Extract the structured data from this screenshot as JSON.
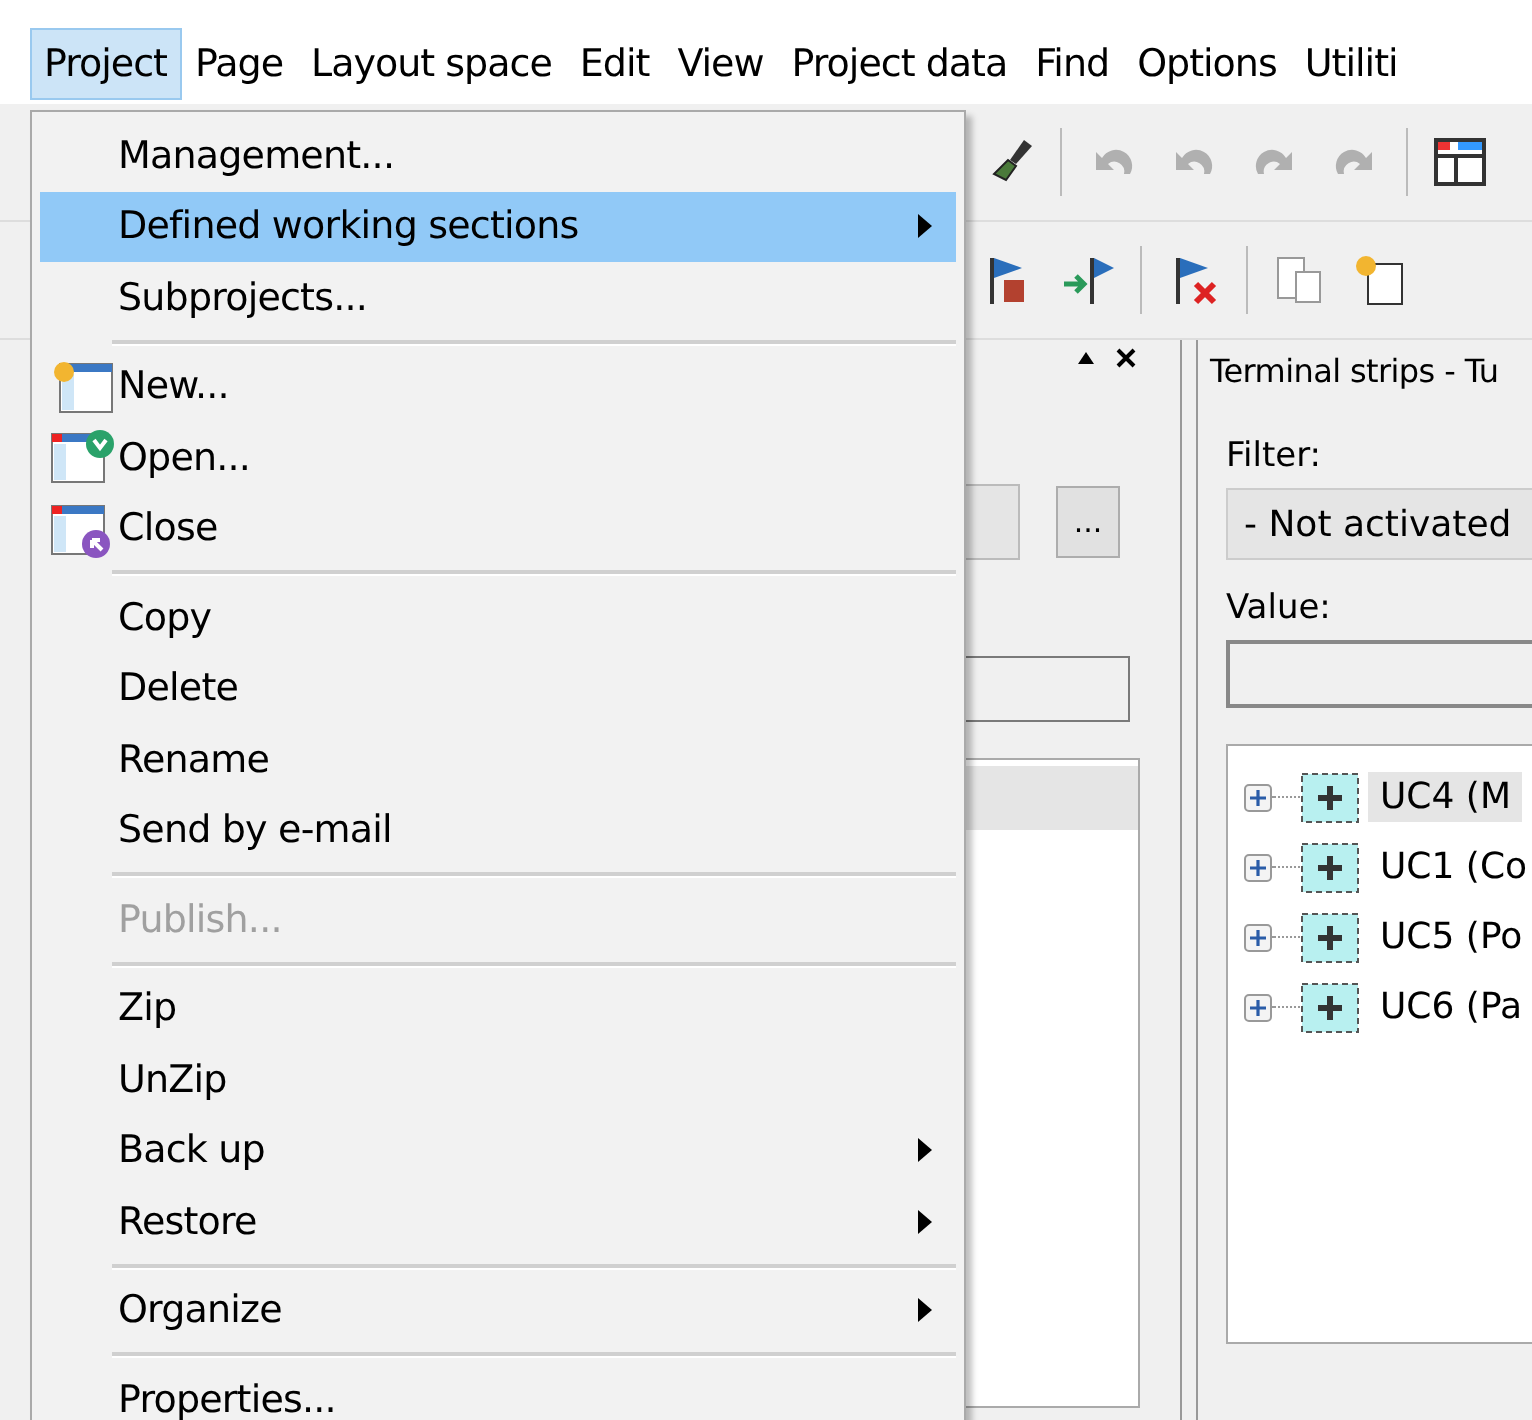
{
  "menu_bar": [
    {
      "label": "Project",
      "selected": true
    },
    {
      "label": "Page",
      "selected": false
    },
    {
      "label": "Layout space",
      "selected": false
    },
    {
      "label": "Edit",
      "selected": false
    },
    {
      "label": "View",
      "selected": false
    },
    {
      "label": "Project data",
      "selected": false
    },
    {
      "label": "Find",
      "selected": false
    },
    {
      "label": "Options",
      "selected": false
    },
    {
      "label": "Utiliti",
      "selected": false
    }
  ],
  "project_menu": {
    "items": [
      {
        "kind": "item",
        "label": "Management...",
        "selected": false,
        "disabled": false,
        "submenu": false
      },
      {
        "kind": "item",
        "label": "Defined working sections",
        "selected": true,
        "disabled": false,
        "submenu": true
      },
      {
        "kind": "item",
        "label": "Subprojects...",
        "selected": false,
        "disabled": false,
        "submenu": false
      },
      {
        "kind": "separator"
      },
      {
        "kind": "icon_item",
        "label": "New...",
        "selected": false,
        "disabled": false,
        "submenu": false
      },
      {
        "kind": "icon_item",
        "label": "Open...",
        "selected": false,
        "disabled": false,
        "submenu": false
      },
      {
        "kind": "icon_item",
        "label": "Close",
        "selected": false,
        "disabled": false,
        "submenu": false
      },
      {
        "kind": "separator"
      },
      {
        "kind": "item",
        "label": "Copy",
        "selected": false,
        "disabled": false,
        "submenu": false
      },
      {
        "kind": "item",
        "label": "Delete",
        "selected": false,
        "disabled": false,
        "submenu": false
      },
      {
        "kind": "item",
        "label": "Rename",
        "selected": false,
        "disabled": false,
        "submenu": false
      },
      {
        "kind": "item",
        "label": "Send by e-mail",
        "selected": false,
        "disabled": false,
        "submenu": false
      },
      {
        "kind": "separator"
      },
      {
        "kind": "item",
        "label": "Publish...",
        "selected": false,
        "disabled": true,
        "submenu": false
      },
      {
        "kind": "separator"
      },
      {
        "kind": "item",
        "label": "Zip",
        "selected": false,
        "disabled": false,
        "submenu": false
      },
      {
        "kind": "item",
        "label": "UnZip",
        "selected": false,
        "disabled": false,
        "submenu": false
      },
      {
        "kind": "item",
        "label": "Back up",
        "selected": false,
        "disabled": false,
        "submenu": true
      },
      {
        "kind": "item",
        "label": "Restore",
        "selected": false,
        "disabled": false,
        "submenu": true
      },
      {
        "kind": "separator"
      },
      {
        "kind": "item",
        "label": "Organize",
        "selected": false,
        "disabled": false,
        "submenu": true
      },
      {
        "kind": "separator"
      },
      {
        "kind": "item",
        "label": "Properties...",
        "selected": false,
        "disabled": false,
        "submenu": false
      }
    ]
  },
  "left_panel": {
    "browse_button": "..."
  },
  "terminal_panel": {
    "title": "Terminal strips - Tu",
    "filter_label": "Filter:",
    "filter_value": "- Not activated",
    "value_label": "Value:",
    "tree": [
      {
        "label": "UC4 (M",
        "selected": true,
        "expanded": false
      },
      {
        "label": "UC1 (Co",
        "selected": false,
        "expanded": false
      },
      {
        "label": "UC5 (Po",
        "selected": false,
        "expanded": false
      },
      {
        "label": "UC6 (Pa",
        "selected": false,
        "expanded": false
      }
    ]
  }
}
